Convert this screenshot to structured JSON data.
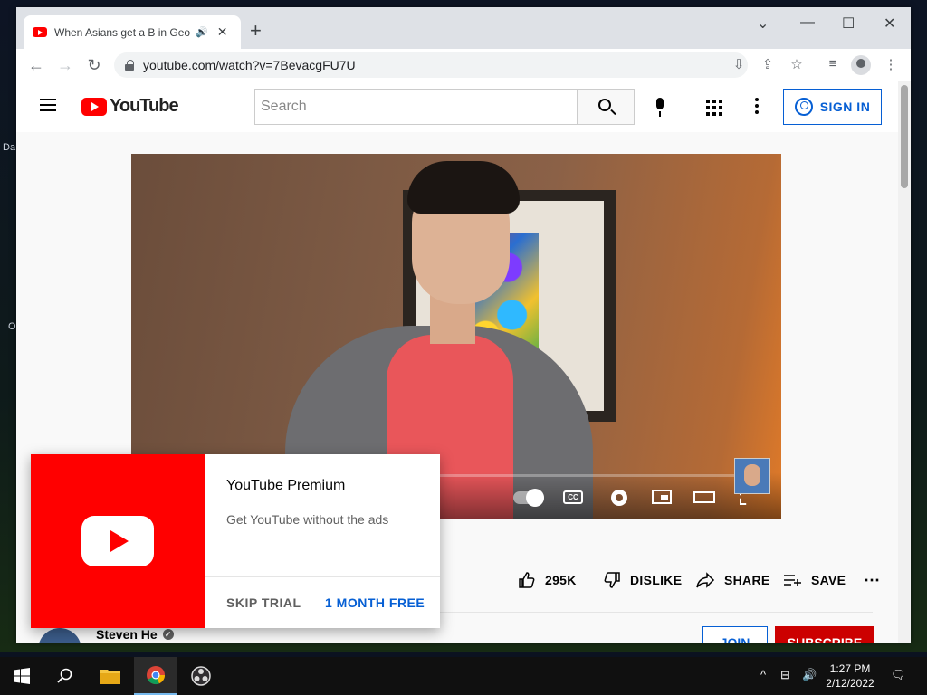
{
  "desktop": {
    "labels": [
      "Da",
      "O"
    ]
  },
  "browser": {
    "tab_title": "When Asians get a B in Geography",
    "tab_audio_glyph": "🔊",
    "url": "youtube.com/watch?v=7BevacgFU7U"
  },
  "youtube": {
    "logo_text": "YouTube",
    "search_placeholder": "Search",
    "sign_in_label": "SIGN IN",
    "video": {
      "progress_fraction": 0.0
    },
    "actions": {
      "likes": "295K",
      "dislike": "DISLIKE",
      "share": "SHARE",
      "save": "SAVE"
    },
    "channel": {
      "name": "Steven He",
      "join_label": "JOIN",
      "subscribe_label": "SUBSCRIBE"
    }
  },
  "popup": {
    "title": "YouTube Premium",
    "description": "Get YouTube without the ads",
    "skip_label": "SKIP TRIAL",
    "offer_label": "1 MONTH FREE"
  },
  "taskbar": {
    "time": "1:27 PM",
    "date": "2/12/2022"
  },
  "colors": {
    "youtube_red": "#ff0000",
    "link_blue": "#065fd4",
    "subscribe_red": "#cc0000"
  }
}
